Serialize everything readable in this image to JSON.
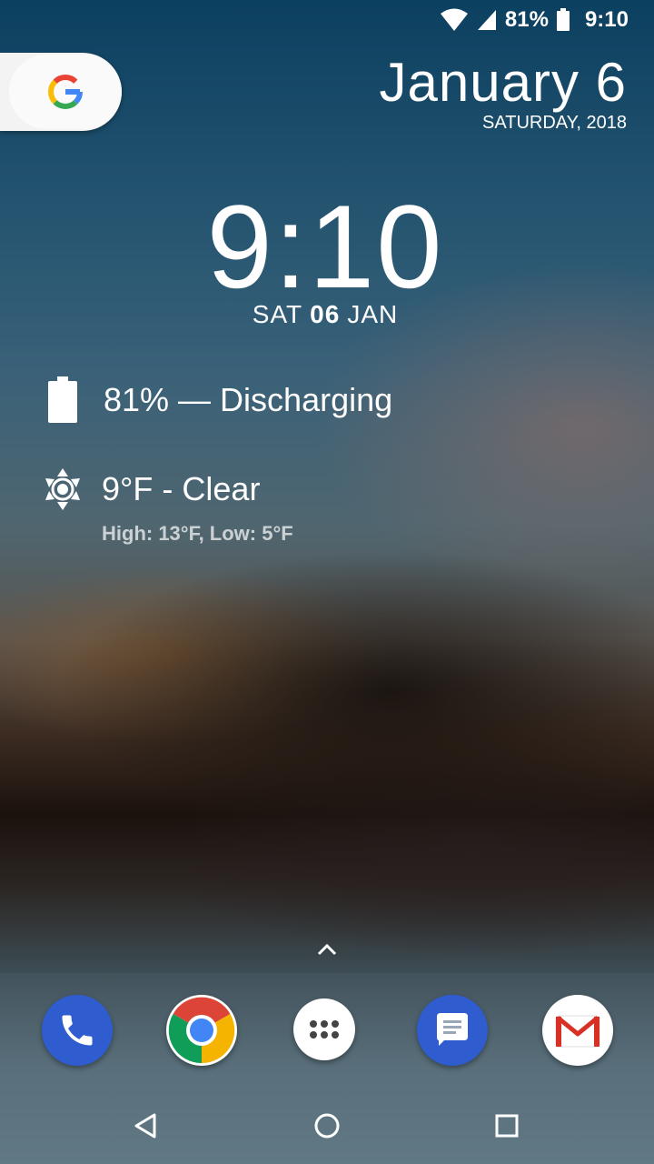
{
  "status_bar": {
    "battery_percent": "81%",
    "time": "9:10",
    "icons": [
      "wifi-icon",
      "cell-signal-icon",
      "battery-icon"
    ]
  },
  "google_search": {
    "icon": "google-g-icon"
  },
  "date_widget": {
    "date": "January 6",
    "subline": "SATURDAY, 2018"
  },
  "clock_widget": {
    "time": "9:10",
    "day": "SAT",
    "date_num": "06",
    "month": "JAN"
  },
  "battery_widget": {
    "text": "81% — Discharging",
    "icon": "battery-full-icon"
  },
  "weather_widget": {
    "text": "9°F - Clear",
    "detail": "High: 13°F, Low: 5°F",
    "icon": "sun-icon"
  },
  "dock": {
    "apps": [
      {
        "name": "phone",
        "icon": "phone-icon",
        "color": "#2f5ccf"
      },
      {
        "name": "chrome",
        "icon": "chrome-icon",
        "color": "#ffffff"
      },
      {
        "name": "app-drawer",
        "icon": "app-drawer-icon",
        "color": "#ffffff"
      },
      {
        "name": "messages",
        "icon": "messages-icon",
        "color": "#2f5ccf"
      },
      {
        "name": "gmail",
        "icon": "gmail-icon",
        "color": "#ffffff"
      }
    ]
  },
  "nav_bar": {
    "icons": [
      "back-icon",
      "home-icon",
      "recents-icon"
    ]
  }
}
